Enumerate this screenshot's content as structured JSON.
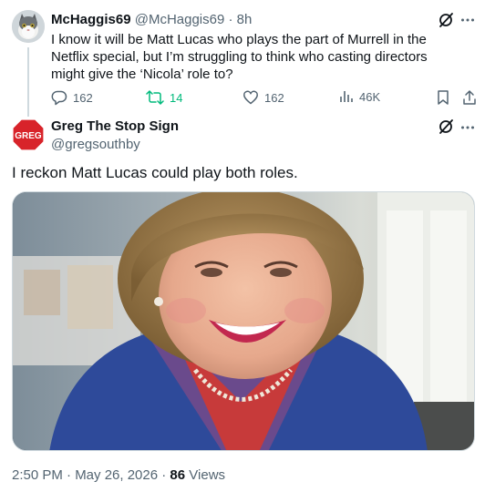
{
  "reply_tweet": {
    "display_name": "McHaggis69",
    "handle": "@McHaggis69",
    "separator": "·",
    "time": "8h",
    "text": "I know it will be Matt Lucas who plays the part of Murrell in the Netflix special, but I’m struggling to think who casting directors might give the ‘Nicola’ role to?",
    "actions": {
      "replies": "162",
      "reposts": "14",
      "likes": "162",
      "views": "46K"
    },
    "icons": [
      "grok-icon",
      "more-icon",
      "reply-icon",
      "repost-icon",
      "like-icon",
      "views-icon",
      "bookmark-icon",
      "share-icon"
    ]
  },
  "main_tweet": {
    "display_name": "Greg The Stop Sign",
    "handle": "@gregsouthby",
    "avatar_text": "GREG",
    "text": "I reckon Matt Lucas could play both roles.",
    "timestamp": "2:50 PM · May 26, 2026 ·",
    "views_count": "86",
    "views_label": "Views"
  },
  "colors": {
    "text_primary": "#0f1419",
    "text_secondary": "#536471",
    "repost_green": "#00ba7c",
    "stop_sign_red": "#d8232a"
  }
}
